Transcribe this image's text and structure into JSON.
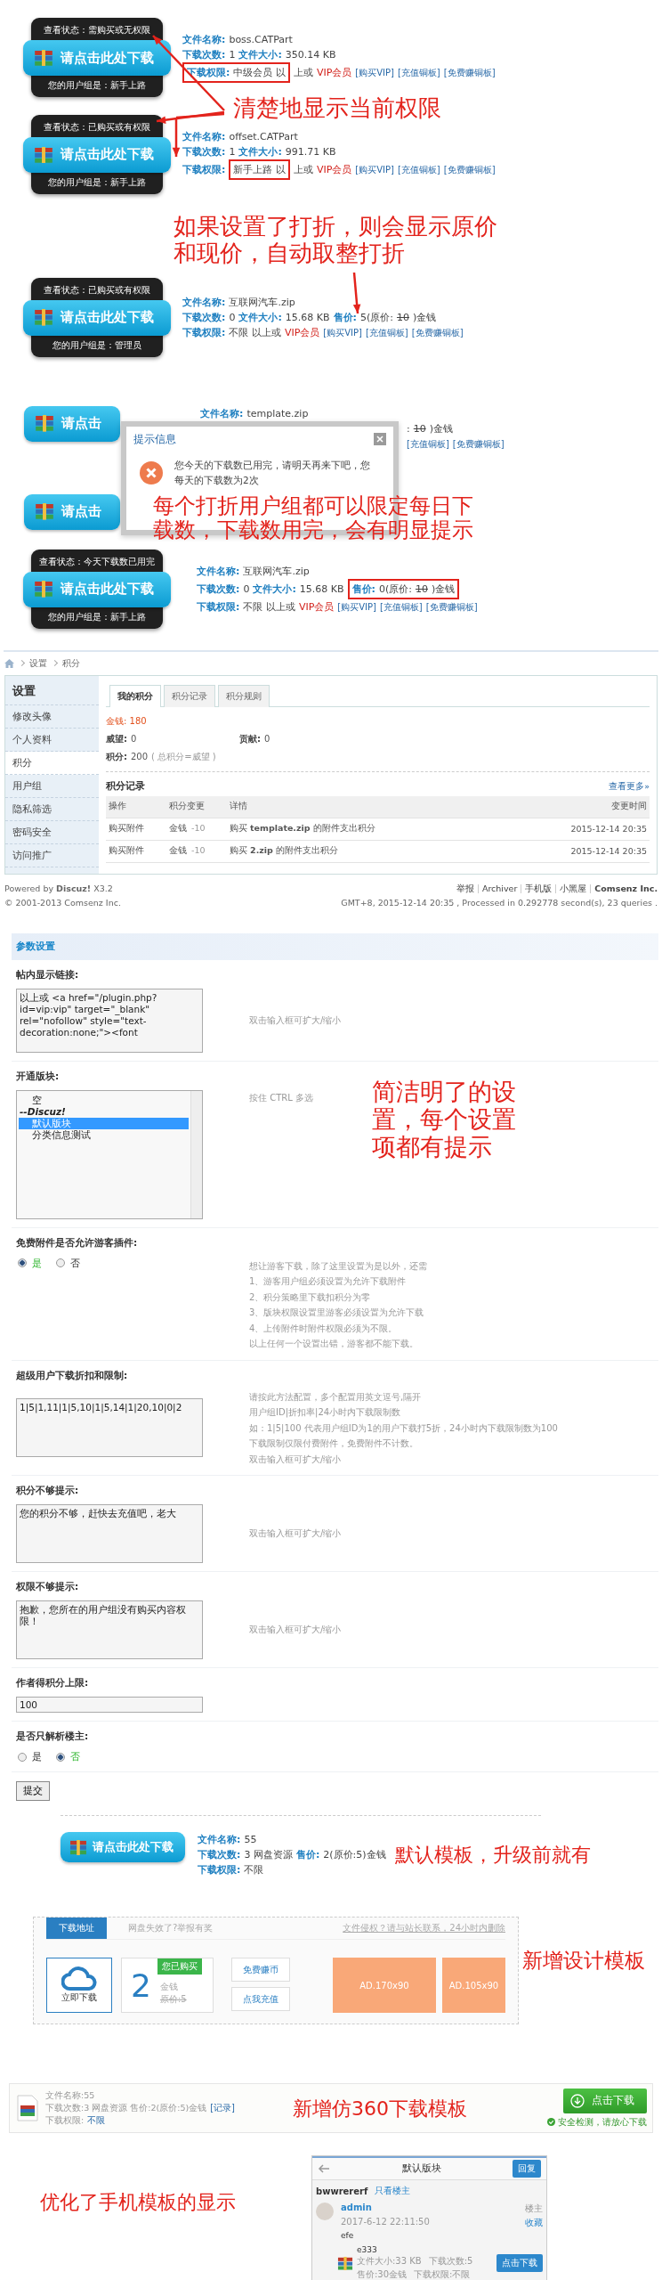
{
  "permission_demo": {
    "annotations": [
      "清楚地显示当前权限",
      "如果设置了打折，则会显示原价和现价，自动取整打折"
    ],
    "widgets": [
      {
        "status": "查看状态：需购买或无权限",
        "button": "请点击此处下载",
        "group": "您的用户组是：新手上路",
        "lines": [
          {
            "segments": [
              {
                "kind": "label",
                "text": "文件名称:"
              },
              {
                "kind": "value",
                "text": "boss.CATPart"
              }
            ]
          },
          {
            "segments": [
              {
                "kind": "label",
                "text": "下载次数:"
              },
              {
                "kind": "value",
                "text": "1"
              },
              {
                "kind": "label",
                "text": "文件大小:"
              },
              {
                "kind": "value",
                "text": "350.14 KB"
              }
            ]
          },
          {
            "segments": [
              {
                "kind": "frame",
                "parts": [
                  {
                    "kind": "label",
                    "text": "下载权限:"
                  },
                  {
                    "kind": "value",
                    "text": "中级会员 以"
                  }
                ]
              },
              {
                "kind": "value",
                "text": "上或"
              },
              {
                "kind": "vip",
                "text": "VIP会员"
              },
              {
                "kind": "link",
                "text": "[购买VIP]"
              },
              {
                "kind": "link",
                "text": "[充值铜板]"
              },
              {
                "kind": "link",
                "text": "[免费赚铜板]"
              }
            ]
          }
        ]
      },
      {
        "status": "查看状态：已购买或有权限",
        "button": "请点击此处下载",
        "group": "您的用户组是：新手上路",
        "lines": [
          {
            "segments": [
              {
                "kind": "label",
                "text": "文件名称:"
              },
              {
                "kind": "value",
                "text": "offset.CATPart"
              }
            ]
          },
          {
            "segments": [
              {
                "kind": "label",
                "text": "下载次数:"
              },
              {
                "kind": "value",
                "text": "1"
              },
              {
                "kind": "label",
                "text": "文件大小:"
              },
              {
                "kind": "value",
                "text": "991.71 KB"
              }
            ]
          },
          {
            "segments": [
              {
                "kind": "label",
                "text": "下载权限:"
              },
              {
                "kind": "frame",
                "parts": [
                  {
                    "kind": "value",
                    "text": "新手上路 以"
                  }
                ]
              },
              {
                "kind": "value",
                "text": "上或"
              },
              {
                "kind": "vip",
                "text": "VIP会员"
              },
              {
                "kind": "link",
                "text": "[购买VIP]"
              },
              {
                "kind": "link",
                "text": "[充值铜板]"
              },
              {
                "kind": "link",
                "text": "[免费赚铜板]"
              }
            ]
          }
        ]
      },
      {
        "status": "查看状态：已购买或有权限",
        "button": "请点击此处下载",
        "group": "您的用户组是：管理员",
        "lines": [
          {
            "segments": [
              {
                "kind": "label",
                "text": "文件名称:"
              },
              {
                "kind": "value",
                "text": "互联网汽车.zip"
              }
            ]
          },
          {
            "segments": [
              {
                "kind": "label",
                "text": "下载次数:"
              },
              {
                "kind": "value",
                "text": "0"
              },
              {
                "kind": "label",
                "text": "文件大小:"
              },
              {
                "kind": "value",
                "text": "15.68 KB"
              },
              {
                "kind": "label",
                "text": "售价:"
              },
              {
                "kind": "value",
                "text": "5(原价:"
              },
              {
                "kind": "strike",
                "text": "10"
              },
              {
                "kind": "value",
                "text": ")金钱"
              }
            ]
          },
          {
            "segments": [
              {
                "kind": "label",
                "text": "下载权限:"
              },
              {
                "kind": "value",
                "text": "不限 以上或"
              },
              {
                "kind": "vip",
                "text": "VIP会员"
              },
              {
                "kind": "link",
                "text": "[购买VIP]"
              },
              {
                "kind": "link",
                "text": "[充值铜板]"
              },
              {
                "kind": "link",
                "text": "[免费赚铜板]"
              }
            ]
          }
        ]
      }
    ]
  },
  "limit_demo": {
    "annotation": "每个打折用户组都可以限定每日下载数，下载数用完，会有明显提示",
    "dialog": {
      "title": "提示信息",
      "message": "您今天的下载数已用完，请明天再来下吧，您每天的下载数为2次"
    },
    "widgets": [
      {
        "button": "请点击",
        "lines": [
          {
            "covered": false,
            "segments": [
              {
                "kind": "label",
                "text": "文件名称:"
              },
              {
                "kind": "value",
                "text": "template.zip"
              }
            ]
          },
          {
            "covered": true,
            "segments": [
              {
                "kind": "value",
                "text": ":"
              },
              {
                "kind": "strike",
                "text": "10"
              },
              {
                "kind": "value",
                "text": ")金钱"
              }
            ]
          },
          {
            "covered": true,
            "segments": [
              {
                "kind": "link",
                "text": "[充值铜板]"
              },
              {
                "kind": "link",
                "text": "[免费赚铜板]"
              }
            ]
          }
        ]
      },
      {
        "button": "请点击"
      },
      {
        "status": "查看状态：今天下载数已用完",
        "button": "请点击此处下载",
        "group": "您的用户组是：新手上路",
        "lines": [
          {
            "covered": false,
            "segments": [
              {
                "kind": "label",
                "text": "文件名称:"
              },
              {
                "kind": "value",
                "text": "互联网汽车.zip"
              }
            ]
          },
          {
            "covered": false,
            "segments": [
              {
                "kind": "label",
                "text": "下载次数:"
              },
              {
                "kind": "value",
                "text": "0"
              },
              {
                "kind": "label",
                "text": "文件大小:"
              },
              {
                "kind": "value",
                "text": "15.68 KB"
              },
              {
                "kind": "frame",
                "parts": [
                  {
                    "kind": "label",
                    "text": "售价:"
                  },
                  {
                    "kind": "value",
                    "text": "0(原价:"
                  },
                  {
                    "kind": "strike",
                    "text": "10"
                  },
                  {
                    "kind": "value",
                    "text": ")金钱"
                  }
                ]
              }
            ]
          },
          {
            "covered": false,
            "segments": [
              {
                "kind": "label",
                "text": "下载权限:"
              },
              {
                "kind": "value",
                "text": "不限 以上或"
              },
              {
                "kind": "vip",
                "text": "VIP会员"
              },
              {
                "kind": "link",
                "text": "[购买VIP]"
              },
              {
                "kind": "link",
                "text": "[充值铜板]"
              },
              {
                "kind": "link",
                "text": "[免费赚铜板]"
              }
            ]
          }
        ]
      }
    ]
  },
  "profile_page": {
    "breadcrumb": [
      "设置",
      "积分"
    ],
    "sidebar": {
      "title": "设置",
      "items": [
        {
          "label": "修改头像",
          "selected": false
        },
        {
          "label": "个人资料",
          "selected": false
        },
        {
          "label": "积分",
          "selected": true
        },
        {
          "label": "用户组",
          "selected": false
        },
        {
          "label": "隐私筛选",
          "selected": false
        },
        {
          "label": "密码安全",
          "selected": false
        },
        {
          "label": "访问推广",
          "selected": false
        }
      ]
    },
    "tabs": [
      {
        "label": "我的积分",
        "selected": true
      },
      {
        "label": "积分记录",
        "selected": false
      },
      {
        "label": "积分规则",
        "selected": false
      }
    ],
    "money": {
      "label": "金钱:",
      "value": "180"
    },
    "stats": [
      {
        "label": "威望:",
        "value": "0"
      },
      {
        "label": "贡献:",
        "value": "0"
      }
    ],
    "total": {
      "label": "积分:",
      "value": "200",
      "note": "( 总积分=威望 )"
    },
    "log": {
      "title": "积分记录",
      "more": "查看更多»",
      "columns": [
        "操作",
        "积分变更",
        "详情",
        "变更时间"
      ],
      "rows": [
        {
          "action": "购买附件",
          "currency": "金钱",
          "change": "-10",
          "detail": "购买 **template.zip** 的附件支出积分",
          "time": "2015-12-14 20:35"
        },
        {
          "action": "购买附件",
          "currency": "金钱",
          "change": "-10",
          "detail": "购买 **2.zip** 的附件支出积分",
          "time": "2015-12-14 20:35"
        }
      ]
    },
    "footer": {
      "powered": "Powered by **Discuz!** X3.2",
      "copyright": "© 2001-2013 Comsenz Inc.",
      "links": [
        {
          "label": "举报",
          "bold": false
        },
        {
          "label": "Archiver",
          "bold": false
        },
        {
          "label": "手机版",
          "bold": false
        },
        {
          "label": "小黑屋",
          "bold": false
        },
        {
          "label": "Comsenz Inc.",
          "bold": true
        }
      ],
      "stats": "GMT+8, 2015-12-14 20:35 , Processed in 0.292778 second(s), 23 queries ."
    }
  },
  "settings": {
    "title": "参数设置",
    "annotation": "简洁明了的设置，每个设置项都有提示",
    "rows": [
      {
        "kind": "textarea",
        "label": "帖内显示链接:",
        "value": "以上或 <a href=\"/plugin.php?id=vip:vip\" target=\"_blank\" rel=\"nofollow\" style=\"text-decoration:none;\"><font",
        "hint": [
          "双击输入框可扩大/缩小"
        ]
      },
      {
        "kind": "listbox",
        "label": "开通版块:",
        "options": [
          {
            "label": "空",
            "kind": "option",
            "selected": false
          },
          {
            "label": "--Discuz!",
            "kind": "group",
            "selected": false
          },
          {
            "label": "默认版块",
            "kind": "option",
            "selected": true
          },
          {
            "label": "分类信息测试",
            "kind": "option",
            "selected": false
          }
        ],
        "hint": [
          "按住 CTRL 多选"
        ]
      },
      {
        "kind": "radio",
        "label": "免费附件是否允许游客插件:",
        "options": [
          {
            "label": "是",
            "selected": true
          },
          {
            "label": "否",
            "selected": false
          }
        ],
        "hint": [
          "想让游客下载，除了这里设置为是以外，还需",
          "1、游客用户组必须设置为允许下载附件",
          "2、积分策略里下载扣积分为零",
          "3、版块权限设置里游客必须设置为允许下载",
          "4、上传附件时附件权限必须为不限。",
          "以上任何一个设置出错，游客都不能下载。"
        ]
      },
      {
        "kind": "textarea",
        "label": "超级用户下载折扣和限制:",
        "value": "1|5|1,11|1|5,10|1|5,14|1|20,10|0|2",
        "hint": [
          "请按此方法配置，多个配置用英文逗号,隔开",
          "用户组ID|折扣率|24小时内下载限制数",
          "如：1|5|100 代表用户组ID为1的用户下载打5折，24小时内下载限制数为100",
          "下载限制仅限付费附件，免费附件不计数。",
          "双击输入框可扩大/缩小"
        ]
      },
      {
        "kind": "textarea",
        "label": "积分不够提示:",
        "value": "您的积分不够，赶快去充值吧，老大",
        "hint": [
          "双击输入框可扩大/缩小"
        ]
      },
      {
        "kind": "textarea",
        "label": "权限不够提示:",
        "value": "抱歉，您所在的用户组没有购买内容权限！",
        "hint": [
          "双击输入框可扩大/缩小"
        ]
      },
      {
        "kind": "input",
        "label": "作者得积分上限:",
        "value": "100"
      },
      {
        "kind": "radio",
        "label": "是否只解析楼主:",
        "options": [
          {
            "label": "是",
            "selected": false
          },
          {
            "label": "否",
            "selected": true
          }
        ]
      }
    ],
    "submit": "提交"
  },
  "default_template": {
    "button": "请点击此处下载",
    "annotation": "默认模板，升级前就有",
    "lines": [
      {
        "segments": [
          {
            "kind": "label",
            "text": "文件名称:"
          },
          {
            "kind": "value",
            "text": "55"
          }
        ]
      },
      {
        "segments": [
          {
            "kind": "label",
            "text": "下载次数:"
          },
          {
            "kind": "value",
            "text": "3 网盘资源"
          },
          {
            "kind": "label",
            "text": "售价:"
          },
          {
            "kind": "value",
            "text": "2(原价:5)金钱"
          }
        ]
      },
      {
        "segments": [
          {
            "kind": "label",
            "text": "下载权限:"
          },
          {
            "kind": "value",
            "text": "不限"
          }
        ]
      }
    ]
  },
  "design_template": {
    "annotation": "新增设计模板",
    "tabs": [
      {
        "label": "下载地址",
        "selected": true
      },
      {
        "label": "网盘失效了?举报有奖",
        "selected": false
      }
    ],
    "notice": "文件侵权？请与站长联系，24小时内删除",
    "download": "立即下载",
    "count": "2",
    "badge": "您已购买",
    "currency": "金钱",
    "original": "原价:5",
    "buttons": [
      "免费赚币",
      "点我充值"
    ],
    "ads": [
      "AD.170x90",
      "AD.105x90"
    ]
  },
  "download_360": {
    "annotation": "新增仿360下载模板",
    "lines": [
      {
        "segments": [
          {
            "kind": "muted",
            "text": "文件名称:55"
          }
        ]
      },
      {
        "segments": [
          {
            "kind": "muted",
            "text": "下载次数:3  网盘资源  售价:2(原价:5)金钱"
          },
          {
            "kind": "link",
            "text": "[记录]"
          }
        ]
      },
      {
        "segments": [
          {
            "kind": "muted",
            "text": "下载权限:"
          },
          {
            "kind": "link",
            "text": "不限"
          }
        ]
      }
    ],
    "button": "点击下载",
    "safety": "安全检测，请放心下载"
  },
  "mobile": {
    "annotation": "优化了手机模板的显示",
    "title": "默认版块",
    "action": "回复",
    "thread_author": "bwwrererf",
    "only_author": "只看楼主",
    "post": {
      "author": "admin",
      "role": "楼主",
      "time": "2017-6-12 22:11:50",
      "favorite": "收藏",
      "body": "efe",
      "attachment": {
        "name": "e333",
        "meta": [
          [
            "文件大小:33 KB",
            "下载次数:5"
          ],
          [
            "售价:30金钱",
            "下载权限:不限"
          ]
        ],
        "button": "点击下载"
      }
    }
  }
}
